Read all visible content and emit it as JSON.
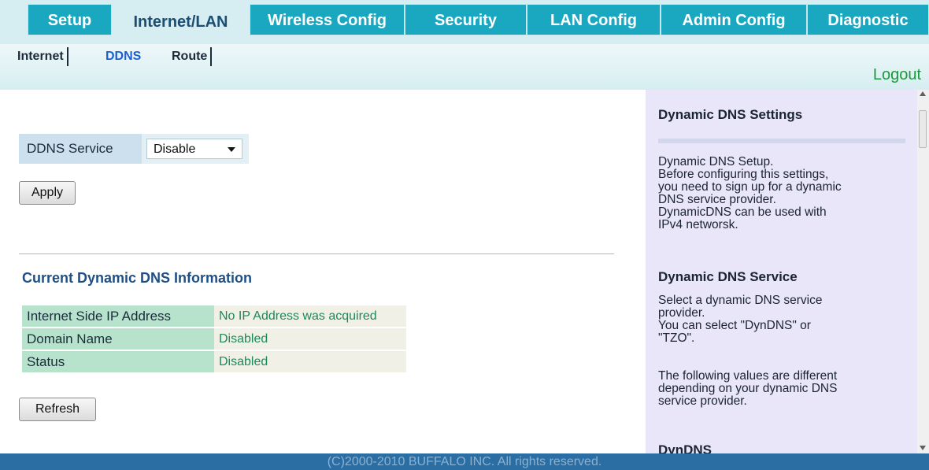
{
  "nav": {
    "tabs": [
      "Setup",
      "Internet/LAN",
      "Wireless Config",
      "Security",
      "LAN Config",
      "Admin Config",
      "Diagnostic"
    ],
    "active_tab": "Internet/LAN",
    "subtabs": [
      "Internet",
      "DDNS",
      "Route"
    ],
    "active_subtab": "DDNS",
    "logout": "Logout"
  },
  "main": {
    "ddns_label": "DDNS Service",
    "ddns_value": "Disable",
    "apply": "Apply",
    "current_title": "Current Dynamic DNS Information",
    "rows": [
      {
        "key": "Internet Side IP Address",
        "value": "No IP Address was acquired"
      },
      {
        "key": "Domain Name",
        "value": "Disabled"
      },
      {
        "key": "Status",
        "value": "Disabled"
      }
    ],
    "refresh": "Refresh"
  },
  "help": {
    "title1": "Dynamic DNS Settings",
    "p1": [
      "Dynamic DNS Setup.",
      "Before configuring this settings,",
      "you need to sign up for a dynamic",
      "DNS service provider.",
      "DynamicDNS can be used with",
      "IPv4 networsk."
    ],
    "title2": "Dynamic DNS Service",
    "p2": [
      "Select a dynamic DNS service",
      "provider.",
      "You can select \"DynDNS\" or",
      "\"TZO\"."
    ],
    "p3": [
      "The following values are different",
      "depending on your dynamic DNS",
      "service provider."
    ],
    "title3": "DynDNS"
  },
  "footer": "(C)2000-2010 BUFFALO INC. All rights reserved.",
  "colors": {
    "tab_bg": "#1aa8c1",
    "nav_bg": "#d6eef1",
    "footer_bg": "#2b6ea3",
    "help_bg": "#e8e6f8",
    "logout": "#1a9a3a"
  }
}
